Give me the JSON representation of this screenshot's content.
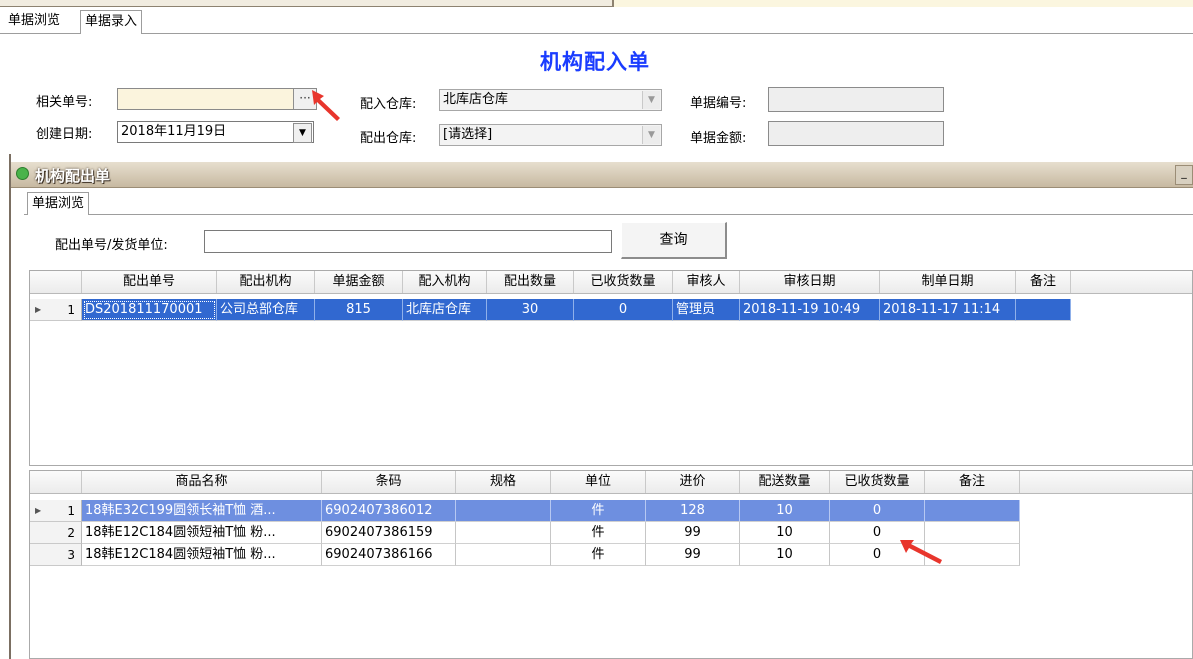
{
  "outer_tabs": [
    {
      "label": "单据浏览",
      "active": false
    },
    {
      "label": "单据录入",
      "active": true
    }
  ],
  "form": {
    "title": "机构配入单",
    "related_no_label": "相关单号:",
    "related_no_value": "",
    "create_date_label": "创建日期:",
    "create_date_value": "2018年11月19日",
    "in_warehouse_label": "配入仓库:",
    "in_warehouse_value": "北库店仓库",
    "out_warehouse_label": "配出仓库:",
    "out_warehouse_value": "[请选择]",
    "doc_no_label": "单据编号:",
    "doc_no_value": "",
    "doc_amount_label": "单据金额:",
    "doc_amount_value": "",
    "ellipsis": "···"
  },
  "dialog": {
    "title": "机构配出单",
    "minimize": "_",
    "tab": "单据浏览",
    "search_label": "配出单号/发货单位:",
    "search_value": "",
    "query_button": "查询"
  },
  "orders_grid": {
    "columns": [
      "配出单号",
      "配出机构",
      "单据金额",
      "配入机构",
      "配出数量",
      "已收货数量",
      "审核人",
      "审核日期",
      "制单日期",
      "备注"
    ],
    "rows": [
      {
        "index": "1",
        "cells": [
          "DS201811170001",
          "公司总部仓库",
          "815",
          "北库店仓库",
          "30",
          "0",
          "管理员",
          "2018-11-19 10:49",
          "2018-11-17 11:14",
          ""
        ]
      }
    ]
  },
  "items_grid": {
    "columns": [
      "商品名称",
      "条码",
      "规格",
      "单位",
      "进价",
      "配送数量",
      "已收货数量",
      "备注"
    ],
    "rows": [
      {
        "index": "1",
        "cells": [
          "18韩E32C199圆领长袖T恤 酒...",
          "6902407386012",
          "",
          "件",
          "128",
          "10",
          "0",
          ""
        ]
      },
      {
        "index": "2",
        "cells": [
          "18韩E12C184圆领短袖T恤 粉...",
          "6902407386159",
          "",
          "件",
          "99",
          "10",
          "0",
          ""
        ]
      },
      {
        "index": "3",
        "cells": [
          "18韩E12C184圆领短袖T恤 粉...",
          "6902407386166",
          "",
          "件",
          "99",
          "10",
          "0",
          ""
        ]
      }
    ]
  },
  "colors": {
    "selection": "#3168d0",
    "selection_light": "#6e8fe0",
    "title_blue": "#1a3cff",
    "annotation_red": "#e8352c"
  }
}
